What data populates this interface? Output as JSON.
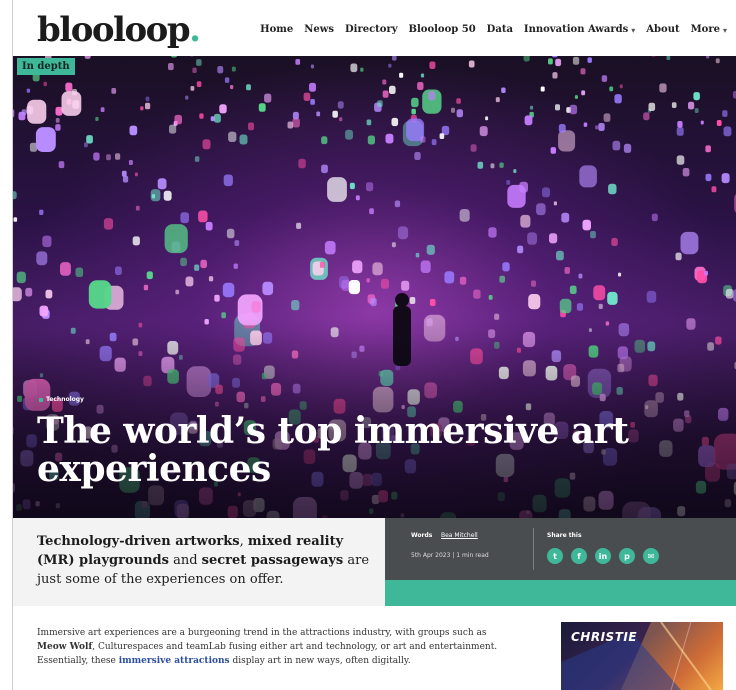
{
  "site": {
    "logo_text": "blooloop",
    "logo_dot": "."
  },
  "nav": {
    "items": [
      {
        "label": "Home",
        "has_caret": false
      },
      {
        "label": "News",
        "has_caret": false
      },
      {
        "label": "Directory",
        "has_caret": false
      },
      {
        "label": "Blooloop 50",
        "has_caret": false
      },
      {
        "label": "Data",
        "has_caret": false
      },
      {
        "label": "Innovation Awards",
        "has_caret": true
      },
      {
        "label": "About",
        "has_caret": false
      },
      {
        "label": "More",
        "has_caret": true
      }
    ]
  },
  "hero": {
    "badge": "In depth",
    "category": "Technology",
    "title": "The world’s top immersive art experiences"
  },
  "standfirst": {
    "part1_bold": "Technology-driven artworks",
    "part2": ", ",
    "part3_bold": "mixed reality (MR) playgrounds",
    "part4": " and ",
    "part5_bold": "secret passageways",
    "part6": " are just some of the experiences on offer."
  },
  "meta": {
    "words_label": "Words",
    "author": "Bea Mitchell",
    "date": "5th Apr 2023 | 1 min read",
    "share_label": "Share this",
    "share_icons": [
      {
        "name": "twitter-icon",
        "glyph": "t"
      },
      {
        "name": "facebook-icon",
        "glyph": "f"
      },
      {
        "name": "linkedin-icon",
        "glyph": "in"
      },
      {
        "name": "pinterest-icon",
        "glyph": "p"
      },
      {
        "name": "email-icon",
        "glyph": "✉"
      }
    ]
  },
  "article": {
    "p1_a": "Immersive art experiences are a burgeoning trend in the attractions industry, with groups such as ",
    "p1_meow": "Meow Wolf",
    "p1_b": ", Culturespaces and teamLab fusing either art and technology, or art and entertainment. Essentially, these ",
    "p1_link": "immersive attractions",
    "p1_c": " display art in new ways, often digitally."
  },
  "ad": {
    "brand": "CHRISTIE"
  },
  "colors": {
    "accent": "#3fb89a",
    "meta_bg": "#4a4d50",
    "link": "#2b4ea0"
  }
}
